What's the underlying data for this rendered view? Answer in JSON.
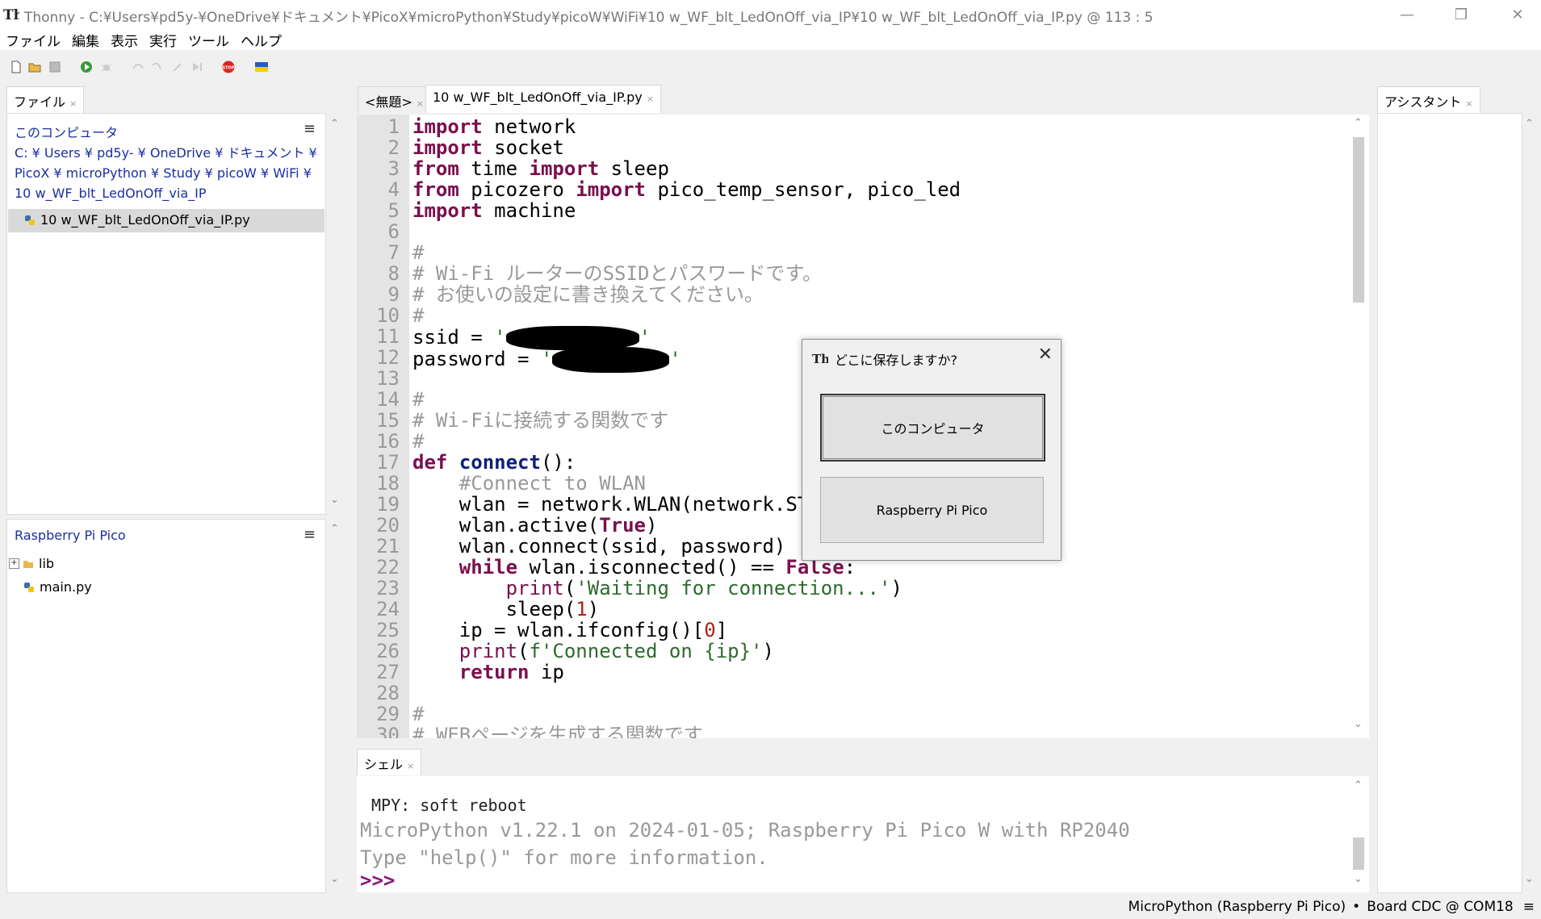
{
  "window": {
    "title": "Thonny  -  C:¥Users¥pd5y-¥OneDrive¥ドキュメント¥PicoX¥microPython¥Study¥picoW¥WiFi¥10 w_WF_blt_LedOnOff_via_IP¥10 w_WF_blt_LedOnOff_via_IP.py  @  113 : 5",
    "minimize": "—",
    "restore": "❐",
    "close": "✕"
  },
  "menu": [
    "ファイル",
    "編集",
    "表示",
    "実行",
    "ツール",
    "ヘルプ"
  ],
  "files_panel": {
    "tab": "ファイル",
    "computer_header": "このコンピュータ",
    "path_lines": [
      "C: ¥ Users ¥ pd5y- ¥ OneDrive ¥ ドキュメント ¥",
      "PicoX ¥ microPython ¥ Study ¥ picoW ¥ WiFi ¥",
      "10 w_WF_blt_LedOnOff_via_IP"
    ],
    "selected_file": "10 w_WF_blt_LedOnOff_via_IP.py",
    "device_header": "Raspberry Pi Pico",
    "device_items": [
      "lib",
      "main.py"
    ],
    "menu_icon": "≡"
  },
  "editor": {
    "tabs": [
      {
        "label": "<無題>"
      },
      {
        "label": "10 w_WF_blt_LedOnOff_via_IP.py"
      }
    ],
    "line_numbers": [
      "1",
      "2",
      "3",
      "4",
      "5",
      "6",
      "7",
      "8",
      "9",
      "10",
      "11",
      "12",
      "13",
      "14",
      "15",
      "16",
      "17",
      "18",
      "19",
      "20",
      "21",
      "22",
      "23",
      "24",
      "25",
      "26",
      "27",
      "28",
      "29",
      "30"
    ]
  },
  "assistant": {
    "tab": "アシスタント"
  },
  "dialog": {
    "title": "どこに保存しますか?",
    "option_computer": "このコンピュータ",
    "option_pico": "Raspberry Pi Pico"
  },
  "shell": {
    "tab": "シェル",
    "line1": "MPY: soft reboot",
    "line2": "MicroPython v1.22.1 on 2024-01-05; Raspberry Pi Pico W with RP2040",
    "line3": "Type \"help()\" for more information.",
    "prompt": ">>>"
  },
  "status": {
    "interpreter": "MicroPython (Raspberry Pi Pico)",
    "separator": "•",
    "port": "Board CDC @ COM18",
    "menu_icon": "≡"
  },
  "colors": {
    "keyword": "#7a0f4d",
    "comment": "#999999",
    "folder_link": "#1a2fa0",
    "prompt": "#8b1a7a"
  }
}
